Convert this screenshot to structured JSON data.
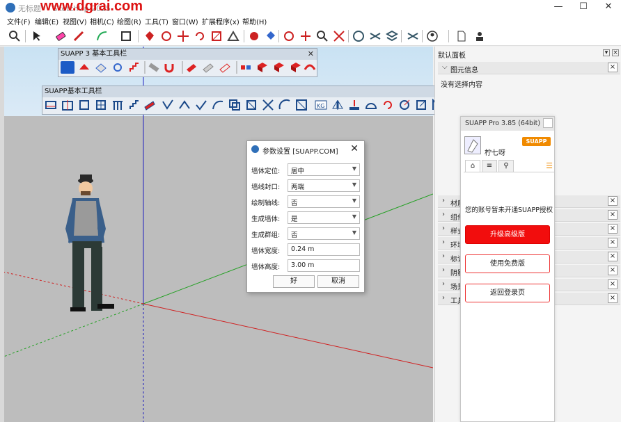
{
  "window": {
    "title": "无标题* - SketchUp 2025",
    "watermark": "www.dgrai.com",
    "controls": [
      "—",
      "☐",
      "✕"
    ]
  },
  "menu": [
    "文件(F)",
    "编辑(E)",
    "视图(V)",
    "相机(C)",
    "绘图(R)",
    "工具(T)",
    "窗口(W)",
    "扩展程序(x)",
    "帮助(H)"
  ],
  "toolbar_suapp3": {
    "title": "SUAPP 3 基本工具栏",
    "close": "✕"
  },
  "toolbar_suapp": {
    "title": "SUAPP基本工具栏",
    "close": "✕"
  },
  "dialog": {
    "title": "参数设置 [SUAPP.COM]",
    "close": "✕",
    "fields": [
      {
        "label": "墙体定位:",
        "value": "居中",
        "type": "select"
      },
      {
        "label": "墙线封口:",
        "value": "两端",
        "type": "select"
      },
      {
        "label": "绘制轴线:",
        "value": "否",
        "type": "select"
      },
      {
        "label": "生成墙体:",
        "value": "是",
        "type": "select"
      },
      {
        "label": "生成群组:",
        "value": "否",
        "type": "select"
      },
      {
        "label": "墙体宽度:",
        "value": "0.24 m",
        "type": "input"
      },
      {
        "label": "墙体高度:",
        "value": "3.00 m",
        "type": "input"
      }
    ],
    "ok_label": "好",
    "cancel_label": "取消"
  },
  "tray": {
    "title": "默认面板",
    "sections": [
      "图元信息",
      "材质",
      "组件",
      "样式",
      "环境",
      "标记",
      "阴影",
      "场景",
      "工具向导"
    ],
    "entity_info_text": "没有选择内容"
  },
  "suapp_panel": {
    "title": "SUAPP Pro 3.85 (64bit)",
    "username": "柠七呀",
    "badge": "SUAPP pro",
    "message": "您的账号暂未开通SUAPP授权",
    "upgrade_label": "升级高级版",
    "free_label": "使用免费版",
    "back_label": "返回登录页"
  },
  "colors": {
    "accent_red": "#f20d0d",
    "badge_orange": "#f08a00",
    "axis_red": "#d02020",
    "axis_green": "#22a022",
    "axis_blue": "#2020c0"
  }
}
